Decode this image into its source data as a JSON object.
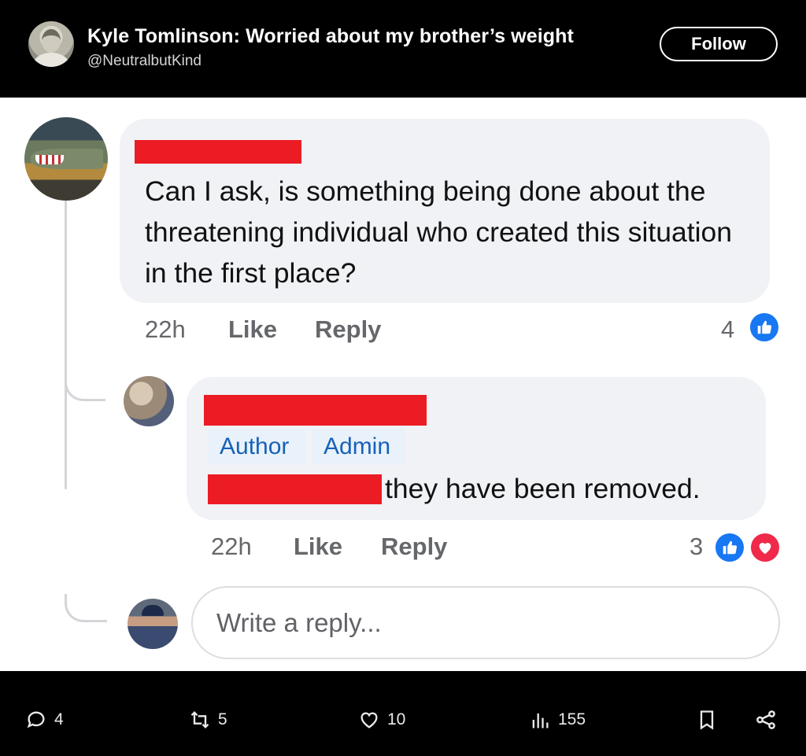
{
  "header": {
    "title": "Kyle Tomlinson: Worried about my brother’s weight",
    "handle": "@NeutralbutKind",
    "follow_label": "Follow"
  },
  "comment": {
    "text": "Can I ask, is something being done about the threatening individual who created this situation in the first place?",
    "time": "22h",
    "like_label": "Like",
    "reply_label": "Reply",
    "reaction_count": "4",
    "reactions": [
      "like-icon"
    ]
  },
  "reply": {
    "badges": [
      "Author",
      "Admin"
    ],
    "text": "they have been removed.",
    "time": "22h",
    "like_label": "Like",
    "reply_label": "Reply",
    "reaction_count": "3",
    "reactions": [
      "like-icon",
      "love-icon"
    ]
  },
  "reply_box": {
    "placeholder": "Write a reply..."
  },
  "actions": {
    "replies": "4",
    "reposts": "5",
    "likes": "10",
    "views": "155"
  },
  "colors": {
    "redaction": "#ec1c24",
    "like_blue": "#1877f2",
    "love_red": "#f02849",
    "bubble_bg": "#f0f2f5",
    "badge_text": "#1761b7"
  }
}
